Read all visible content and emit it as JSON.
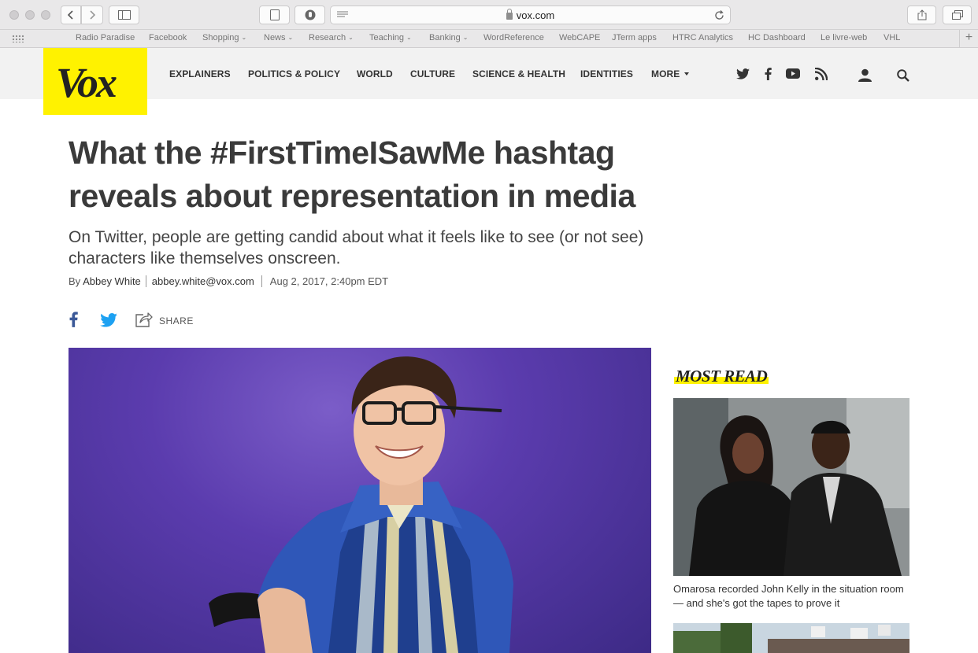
{
  "browser": {
    "url": "vox.com",
    "bookmarks": [
      {
        "label": "Radio Paradise",
        "dropdown": false
      },
      {
        "label": "Facebook",
        "dropdown": false
      },
      {
        "label": "Shopping",
        "dropdown": true
      },
      {
        "label": "News",
        "dropdown": true
      },
      {
        "label": "Research",
        "dropdown": true
      },
      {
        "label": "Teaching",
        "dropdown": true
      },
      {
        "label": "Banking",
        "dropdown": true
      },
      {
        "label": "WordReference",
        "dropdown": false
      },
      {
        "label": "WebCAPE",
        "dropdown": false
      },
      {
        "label": "JTerm apps",
        "dropdown": false
      },
      {
        "label": "HTRC Analytics",
        "dropdown": false
      },
      {
        "label": "HC Dashboard",
        "dropdown": false
      },
      {
        "label": "Le livre-web",
        "dropdown": false
      },
      {
        "label": "VHL",
        "dropdown": false
      }
    ]
  },
  "site": {
    "logo": "Vox",
    "brand_color": "#fff200",
    "nav": [
      "EXPLAINERS",
      "POLITICS & POLICY",
      "WORLD",
      "CULTURE",
      "SCIENCE & HEALTH",
      "IDENTITIES",
      "MORE"
    ],
    "header_icons": [
      "twitter-icon",
      "facebook-icon",
      "youtube-icon",
      "rss-icon",
      "user-icon",
      "search-icon"
    ]
  },
  "article": {
    "headline": "What the #FirstTimeISawMe hashtag reveals about representation in media",
    "dek": "On Twitter, people are getting candid about what it feels like to see (or not see) characters like themselves onscreen.",
    "byline_prefix": "By",
    "author": "Abbey White",
    "email": "abbey.white@vox.com",
    "date": "Aug 2, 2017, 2:40pm EDT",
    "share_label": "SHARE"
  },
  "sidebar": {
    "title": "MOST READ",
    "items": [
      {
        "caption": "Omarosa recorded John Kelly in the situation room — and she's got the tapes to prove it"
      }
    ]
  }
}
